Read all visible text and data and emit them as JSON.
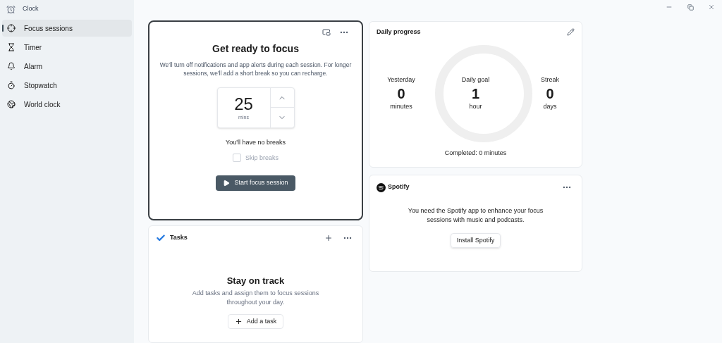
{
  "window": {
    "title": "Clock"
  },
  "nav_items": [
    {
      "label": "Focus sessions",
      "selected": true
    },
    {
      "label": "Timer",
      "selected": false
    },
    {
      "label": "Alarm",
      "selected": false
    },
    {
      "label": "Stopwatch",
      "selected": false
    },
    {
      "label": "World clock",
      "selected": false
    }
  ],
  "focus_card": {
    "title": "Get ready to focus",
    "description": "We'll turn off notifications and app alerts during each session. For longer sessions, we'll add a short break so you can recharge.",
    "minutes": "25",
    "unit": "mins",
    "breaks_note": "You'll have no breaks",
    "skip_breaks": {
      "label": "Skip breaks",
      "checked": false,
      "disabled": true
    },
    "start_button": "Start focus session"
  },
  "daily_progress": {
    "title": "Daily progress",
    "stats": [
      {
        "label": "Yesterday",
        "value": "0",
        "unit": "minutes"
      },
      {
        "label": "Daily goal",
        "value": "1",
        "unit": "hour"
      },
      {
        "label": "Streak",
        "value": "0",
        "unit": "days"
      }
    ],
    "completed": "Completed: 0 minutes"
  },
  "spotify": {
    "brand": "Spotify",
    "description": "You need the Spotify app to enhance your focus sessions with music and podcasts.",
    "install_button": "Install Spotify"
  },
  "tasks": {
    "title": "Tasks",
    "heading": "Stay on track",
    "description": "Add tasks and assign them to focus sessions throughout your day.",
    "add_button": "Add a task"
  }
}
